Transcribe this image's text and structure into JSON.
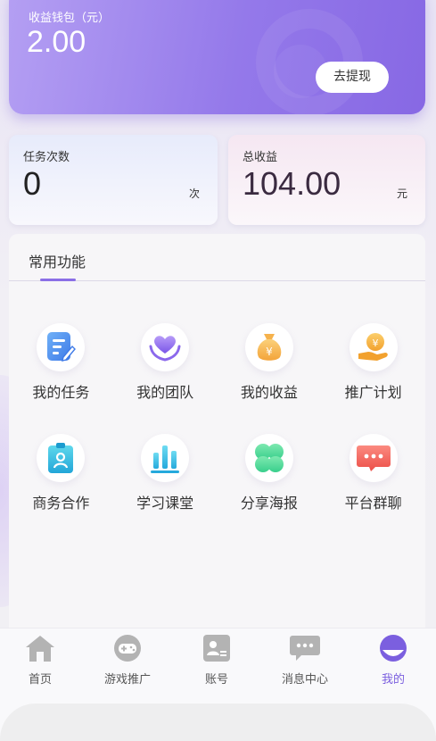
{
  "wallet": {
    "label": "收益钱包（元）",
    "amount": "2.00",
    "withdraw_label": "去提现"
  },
  "stats": {
    "tasks": {
      "label": "任务次数",
      "value": "0",
      "unit": "次"
    },
    "earnings": {
      "label": "总收益",
      "value": "104.00",
      "unit": "元"
    }
  },
  "features": {
    "title": "常用功能",
    "items": [
      {
        "label": "我的任务",
        "icon": "task-list-icon"
      },
      {
        "label": "我的团队",
        "icon": "team-heart-icon"
      },
      {
        "label": "我的收益",
        "icon": "money-bag-icon"
      },
      {
        "label": "推广计划",
        "icon": "hand-coin-icon"
      },
      {
        "label": "商务合作",
        "icon": "id-badge-icon"
      },
      {
        "label": "学习课堂",
        "icon": "bar-chart-icon"
      },
      {
        "label": "分享海报",
        "icon": "clover-icon"
      },
      {
        "label": "平台群聊",
        "icon": "chat-bubble-icon"
      }
    ]
  },
  "tabbar": {
    "items": [
      {
        "label": "首页",
        "icon": "home-icon"
      },
      {
        "label": "游戏推广",
        "icon": "gamepad-icon"
      },
      {
        "label": "账号",
        "icon": "account-card-icon"
      },
      {
        "label": "消息中心",
        "icon": "message-icon"
      },
      {
        "label": "我的",
        "icon": "profile-icon"
      }
    ],
    "active_index": 4
  },
  "colors": {
    "accent": "#8b6fe6",
    "wallet_gradient_start": "#b49ff3",
    "wallet_gradient_end": "#8768e4"
  }
}
